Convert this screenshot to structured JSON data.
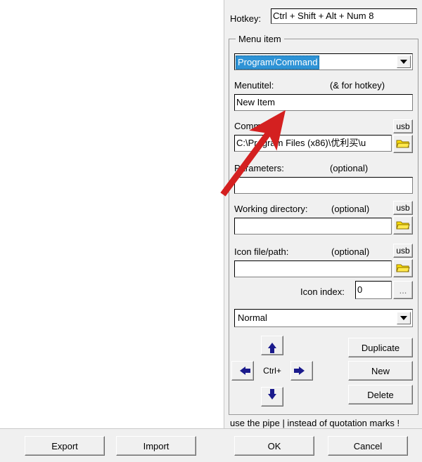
{
  "panel": {
    "hotkey": {
      "label": "Hotkey:",
      "value": "Ctrl + Shift + Alt + Num 8"
    },
    "group": {
      "legend": "Menu item",
      "type_combo": {
        "selected": "Program/Command",
        "arrow_icon": "chevron-down-icon"
      },
      "menutitel": {
        "label": "Menutitel:",
        "hint": "(& for hotkey)",
        "value": "New Item"
      },
      "command": {
        "label": "Command:",
        "value": "C:\\Program Files (x86)\\优利买\\u",
        "usb_label": "usb",
        "browse_icon": "folder-icon"
      },
      "parameters": {
        "label": "Parameters:",
        "hint": "(optional)",
        "value": ""
      },
      "working_directory": {
        "label": "Working directory:",
        "hint": "(optional)",
        "value": "",
        "usb_label": "usb",
        "browse_icon": "folder-icon"
      },
      "icon_file": {
        "label": "Icon file/path:",
        "hint": "(optional)",
        "value": "",
        "usb_label": "usb",
        "browse_icon": "folder-icon"
      },
      "icon_index": {
        "label": "Icon index:",
        "value": "0",
        "more_label": "..."
      },
      "window_state": {
        "selected": "Normal",
        "arrow_icon": "chevron-down-icon"
      },
      "nav": {
        "ctrl_label": "Ctrl+",
        "up_icon": "arrow-up-icon",
        "down_icon": "arrow-down-icon",
        "left_icon": "arrow-left-icon",
        "right_icon": "arrow-right-icon"
      },
      "actions": {
        "duplicate": "Duplicate",
        "new": "New",
        "delete": "Delete"
      }
    },
    "pipe_hint": "use the pipe | instead of quotation marks !"
  },
  "bottom_bar": {
    "export": "Export",
    "import": "Import",
    "ok": "OK",
    "cancel": "Cancel"
  },
  "colors": {
    "panel_background": "#f0f0f0",
    "selection_blue": "#2e93d6",
    "arrow_navy": "#1a1a8c",
    "folder_yellow": "#ffe000",
    "annotation_red": "#d42020"
  }
}
